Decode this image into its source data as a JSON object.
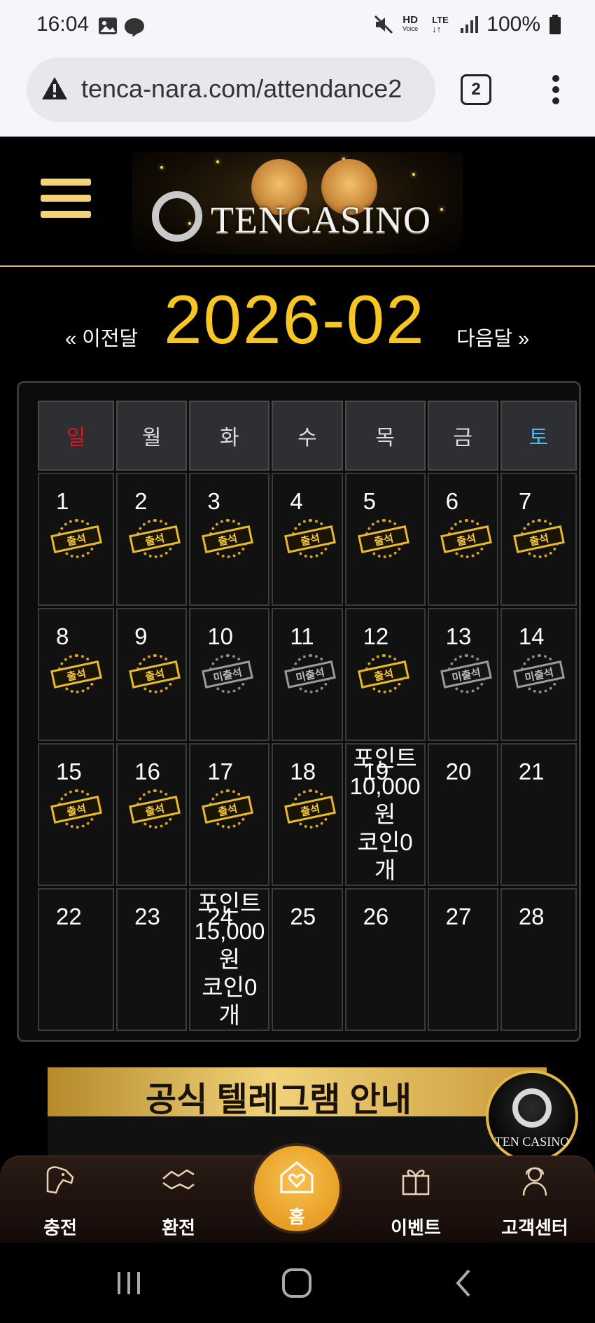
{
  "status_bar": {
    "time": "16:04",
    "battery": "100%",
    "hd_label": "HD",
    "voice_label": "Voice",
    "lte_label": "LTE"
  },
  "browser": {
    "url": "tenca-nara.com/attendance2",
    "tab_count": "2"
  },
  "header": {
    "logo_text": "TENCASINO"
  },
  "month_nav": {
    "prev_label": "« 이전달",
    "month": "2026-02",
    "next_label": "다음달 »"
  },
  "calendar": {
    "weekdays": [
      {
        "label": "일",
        "color": "#e0141e"
      },
      {
        "label": "월",
        "color": "#dddddd"
      },
      {
        "label": "화",
        "color": "#dddddd"
      },
      {
        "label": "수",
        "color": "#dddddd"
      },
      {
        "label": "목",
        "color": "#dddddd"
      },
      {
        "label": "금",
        "color": "#dddddd"
      },
      {
        "label": "토",
        "color": "#5ab8f0"
      }
    ],
    "stamp_attend": "출석",
    "stamp_absent": "미출석",
    "rows": [
      [
        {
          "day": "1",
          "status": "attend"
        },
        {
          "day": "2",
          "status": "attend"
        },
        {
          "day": "3",
          "status": "attend"
        },
        {
          "day": "4",
          "status": "attend"
        },
        {
          "day": "5",
          "status": "attend"
        },
        {
          "day": "6",
          "status": "attend"
        },
        {
          "day": "7",
          "status": "attend"
        }
      ],
      [
        {
          "day": "8",
          "status": "attend"
        },
        {
          "day": "9",
          "status": "attend"
        },
        {
          "day": "10",
          "status": "absent"
        },
        {
          "day": "11",
          "status": "absent"
        },
        {
          "day": "12",
          "status": "attend"
        },
        {
          "day": "13",
          "status": "absent"
        },
        {
          "day": "14",
          "status": "absent"
        }
      ],
      [
        {
          "day": "15",
          "status": "attend"
        },
        {
          "day": "16",
          "status": "attend"
        },
        {
          "day": "17",
          "status": "attend"
        },
        {
          "day": "18",
          "status": "attend"
        },
        {
          "day": "19",
          "status": "reward",
          "reward": [
            "포인트",
            "10,000",
            "원",
            "코인0",
            "개"
          ]
        },
        {
          "day": "20",
          "status": "none"
        },
        {
          "day": "21",
          "status": "none"
        }
      ],
      [
        {
          "day": "22",
          "status": "none"
        },
        {
          "day": "23",
          "status": "none"
        },
        {
          "day": "24",
          "status": "reward",
          "reward": [
            "포인트",
            "15,000",
            "원",
            "코인0",
            "개"
          ]
        },
        {
          "day": "25",
          "status": "none"
        },
        {
          "day": "26",
          "status": "none"
        },
        {
          "day": "27",
          "status": "none"
        },
        {
          "day": "28",
          "status": "none"
        }
      ]
    ]
  },
  "banner": {
    "title": "공식 텔레그램 안내",
    "badge_text": "TEN CASINO"
  },
  "bottom_nav": {
    "charge": "충전",
    "exchange": "환전",
    "home": "홈",
    "event": "이벤트",
    "support": "고객센터"
  },
  "colors": {
    "accent_gold": "#f7c622",
    "brand_orange": "#e79e23"
  }
}
